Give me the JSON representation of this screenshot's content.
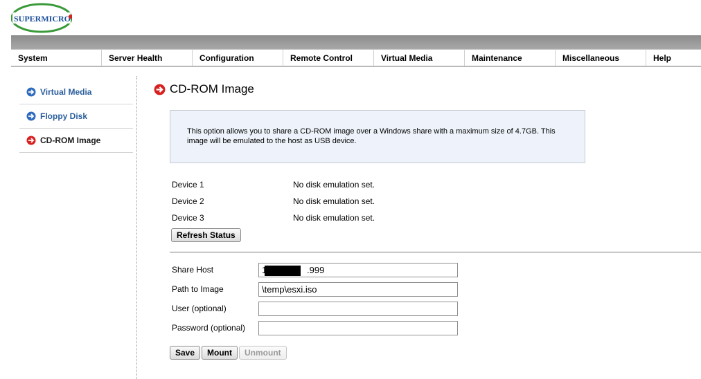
{
  "logo": {
    "text": "SUPERMICRO"
  },
  "menu": [
    {
      "label": "System"
    },
    {
      "label": "Server Health"
    },
    {
      "label": "Configuration"
    },
    {
      "label": "Remote Control"
    },
    {
      "label": "Virtual Media"
    },
    {
      "label": "Maintenance"
    },
    {
      "label": "Miscellaneous"
    },
    {
      "label": "Help"
    }
  ],
  "sidebar": {
    "items": [
      {
        "label": "Virtual Media",
        "icon": "arrow-circle-right-icon",
        "color": "#2f6bbd"
      },
      {
        "label": "Floppy Disk",
        "icon": "arrow-circle-right-icon",
        "color": "#2f6bbd"
      },
      {
        "label": "CD-ROM Image",
        "icon": "arrow-circle-right-icon",
        "color": "#d8211f"
      }
    ]
  },
  "page": {
    "title": "CD-ROM Image",
    "info": "This option allows you to share a CD-ROM image over a Windows share with a maximum size of 4.7GB. This image will be emulated to the host as USB device."
  },
  "devices": [
    {
      "label": "Device 1",
      "status": "No disk emulation set."
    },
    {
      "label": "Device 2",
      "status": "No disk emulation set."
    },
    {
      "label": "Device 3",
      "status": "No disk emulation set."
    }
  ],
  "buttons": {
    "refresh": "Refresh Status",
    "save": "Save",
    "mount": "Mount",
    "unmount": "Unmount"
  },
  "form": {
    "share_host": {
      "label": "Share Host",
      "value": "1                .999"
    },
    "path": {
      "label": "Path to Image",
      "value": "\\temp\\esxi.iso"
    },
    "user": {
      "label": "User (optional)",
      "value": ""
    },
    "password": {
      "label": "Password (optional)",
      "value": ""
    }
  },
  "colors": {
    "accent_blue": "#2f6bbd",
    "accent_red": "#d8211f",
    "logo_green": "#3a9a3a"
  }
}
